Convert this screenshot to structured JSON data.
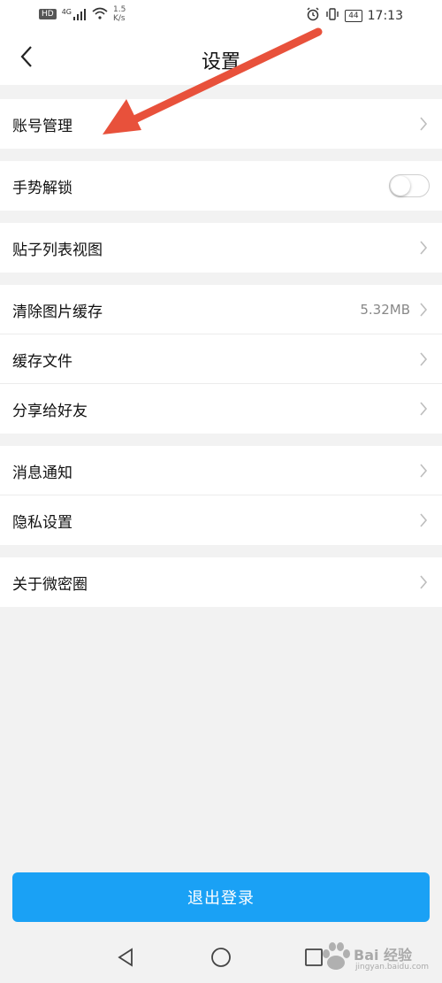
{
  "status_bar": {
    "network_badge": "HD",
    "signal_label": "4G",
    "speed_value": "1.5",
    "speed_unit": "K/s",
    "battery_level": "44",
    "time": "17:13"
  },
  "header": {
    "title": "设置",
    "back_icon": "chevron-left-icon"
  },
  "settings": {
    "account": {
      "label": "账号管理"
    },
    "gesture_lock": {
      "label": "手势解锁",
      "enabled": false
    },
    "post_list_view": {
      "label": "贴子列表视图"
    },
    "clear_image_cache": {
      "label": "清除图片缓存",
      "value": "5.32MB"
    },
    "cache_files": {
      "label": "缓存文件"
    },
    "share_friends": {
      "label": "分享给好友"
    },
    "notifications": {
      "label": "消息通知"
    },
    "privacy": {
      "label": "隐私设置"
    },
    "about": {
      "label": "关于微密圈"
    }
  },
  "logout": {
    "label": "退出登录"
  },
  "colors": {
    "accent": "#1aa1f5",
    "annotation_arrow": "#e8513b",
    "background": "#f2f2f2"
  }
}
